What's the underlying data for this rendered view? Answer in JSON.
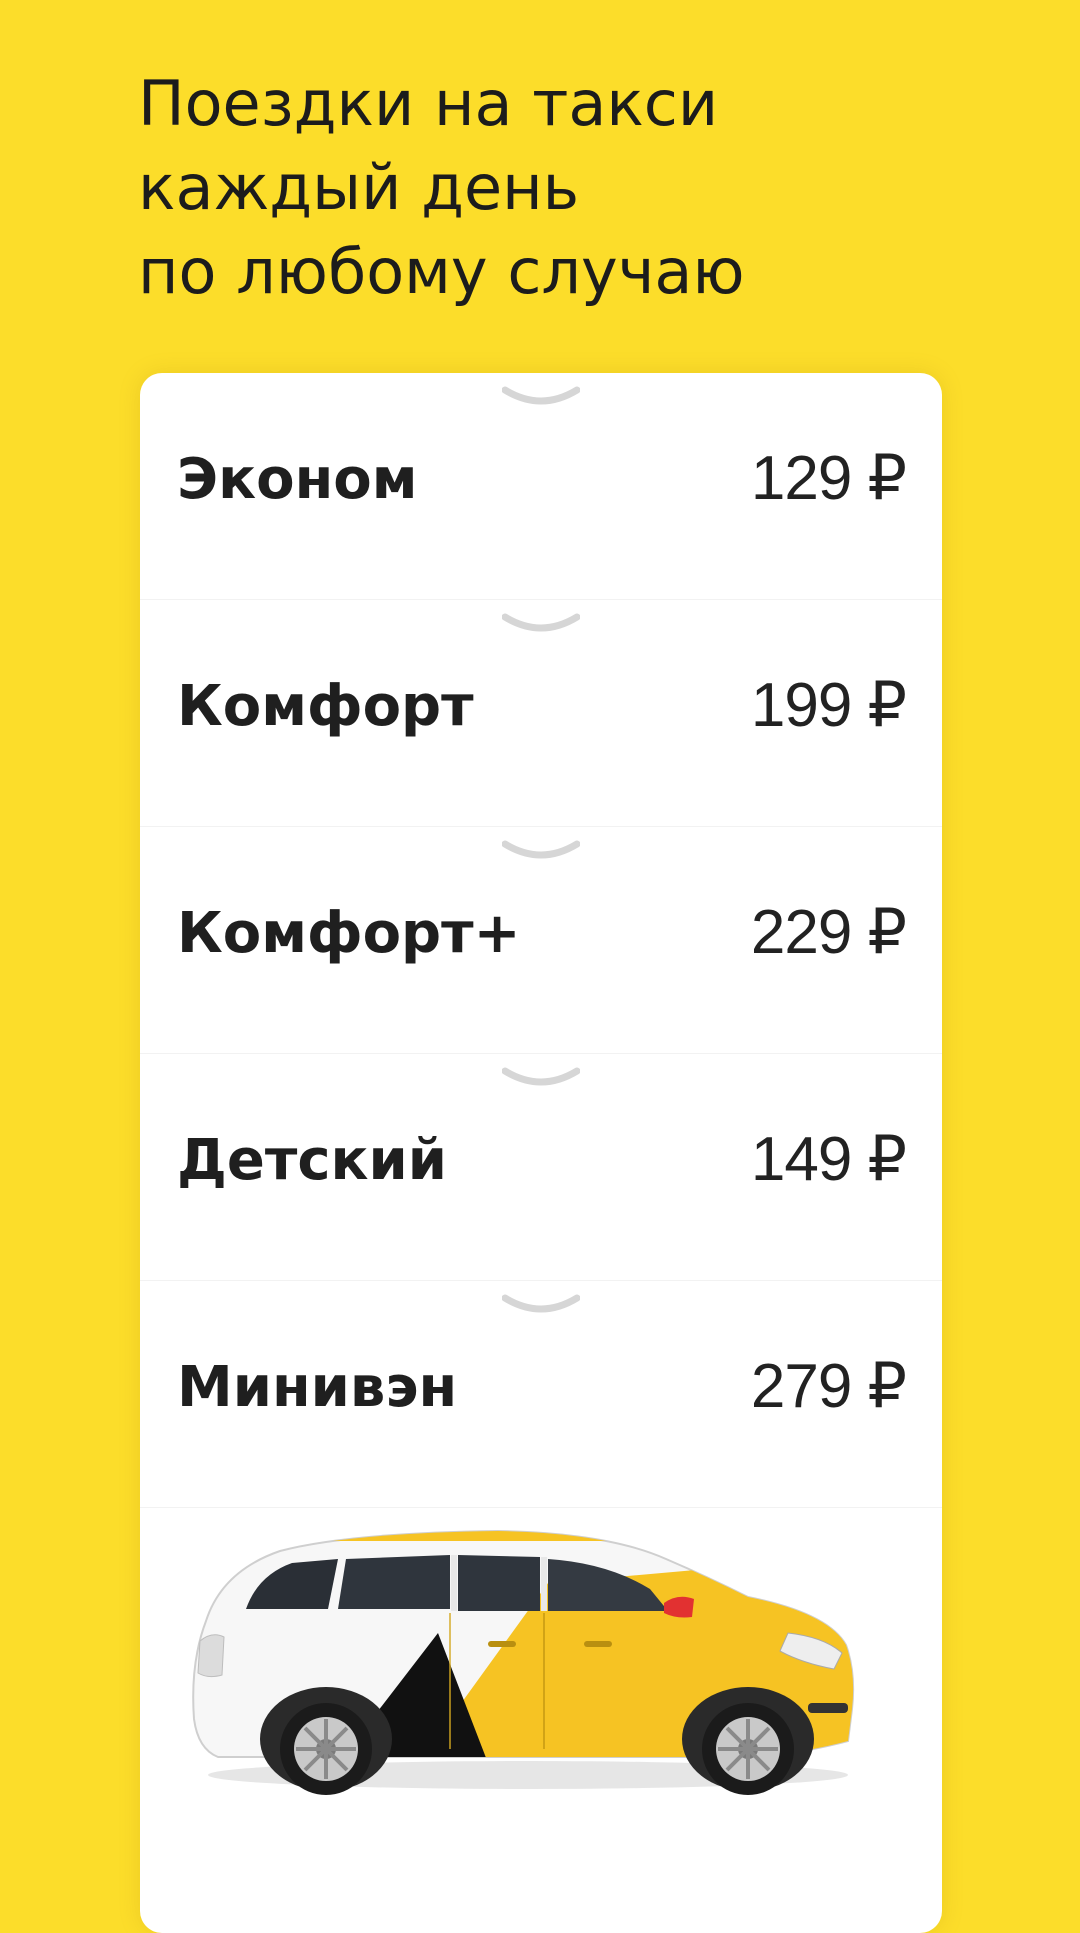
{
  "headline": {
    "line1": "Поездки на такси",
    "line2": "каждый день",
    "line3": "по любому случаю"
  },
  "tariffs": [
    {
      "name": "Эконом",
      "price": "129 ₽"
    },
    {
      "name": "Комфорт",
      "price": "199 ₽"
    },
    {
      "name": "Комфорт+",
      "price": "229 ₽"
    },
    {
      "name": "Детский",
      "price": "149 ₽"
    },
    {
      "name": "Минивэн",
      "price": "279 ₽"
    }
  ],
  "colors": {
    "background": "#FCDD2A",
    "card": "#FFFFFF",
    "text": "#1F1F1F",
    "chevron": "#D6D6D6",
    "car_yellow": "#F6C323",
    "car_black": "#111111"
  },
  "icons": {
    "expand": "chevron-down-icon",
    "car": "minivan-taxi-illustration"
  }
}
